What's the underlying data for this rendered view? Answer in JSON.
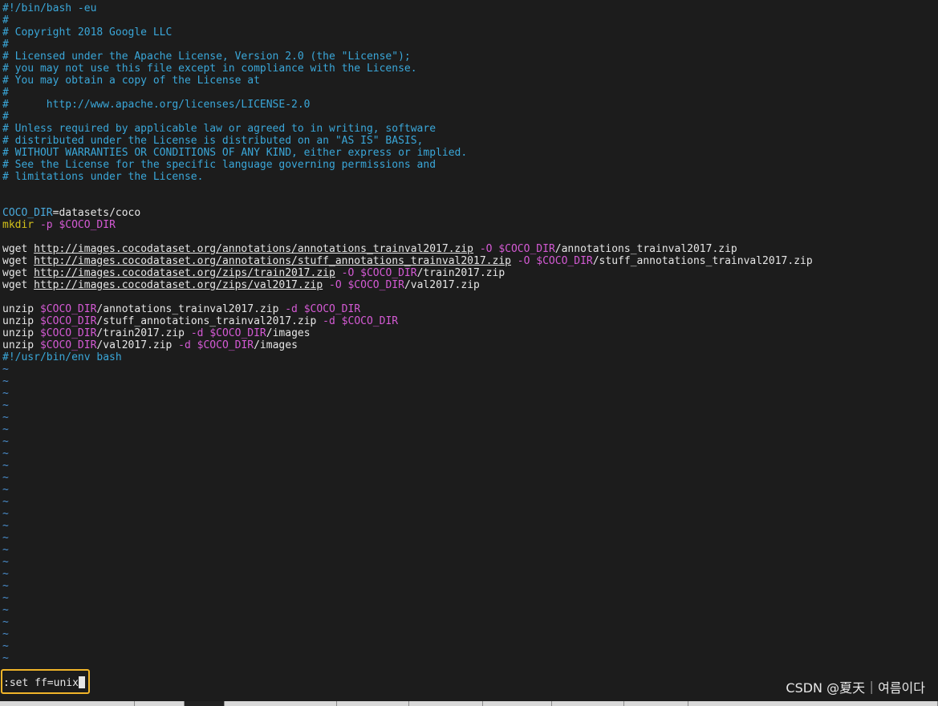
{
  "colors": {
    "background": "#1c1c1c",
    "comment": "#3aa7d9",
    "variable": "#d45ad4",
    "command": "#d4c21a",
    "text": "#e6e6e6",
    "tilde": "#4a8fcf",
    "highlight_box": "#f0b429"
  },
  "editor": {
    "lines": [
      [
        {
          "t": "#!/bin/bash -eu",
          "c": "shebang"
        }
      ],
      [
        {
          "t": "#",
          "c": "comment"
        }
      ],
      [
        {
          "t": "# Copyright 2018 Google LLC",
          "c": "comment"
        }
      ],
      [
        {
          "t": "#",
          "c": "comment"
        }
      ],
      [
        {
          "t": "# Licensed under the Apache License, Version 2.0 (the \"License\");",
          "c": "comment"
        }
      ],
      [
        {
          "t": "# you may not use this file except in compliance with the License.",
          "c": "comment"
        }
      ],
      [
        {
          "t": "# You may obtain a copy of the License at",
          "c": "comment"
        }
      ],
      [
        {
          "t": "#",
          "c": "comment"
        }
      ],
      [
        {
          "t": "#      http://www.apache.org/licenses/LICENSE-2.0",
          "c": "comment"
        }
      ],
      [
        {
          "t": "#",
          "c": "comment"
        }
      ],
      [
        {
          "t": "# Unless required by applicable law or agreed to in writing, software",
          "c": "comment"
        }
      ],
      [
        {
          "t": "# distributed under the License is distributed on an \"AS IS\" BASIS,",
          "c": "comment"
        }
      ],
      [
        {
          "t": "# WITHOUT WARRANTIES OR CONDITIONS OF ANY KIND, either express or implied.",
          "c": "comment"
        }
      ],
      [
        {
          "t": "# See the License for the specific language governing permissions and",
          "c": "comment"
        }
      ],
      [
        {
          "t": "# limitations under the License.",
          "c": "comment"
        }
      ],
      [],
      [],
      [
        {
          "t": "COCO_DIR",
          "c": "ident"
        },
        {
          "t": "=datasets/coco",
          "c": "plain"
        }
      ],
      [
        {
          "t": "mkdir",
          "c": "cmd"
        },
        {
          "t": " -p ",
          "c": "flag"
        },
        {
          "t": "$COCO_DIR",
          "c": "var"
        }
      ],
      [],
      [
        {
          "t": "wget ",
          "c": "plain"
        },
        {
          "t": "http://images.cocodataset.org/annotations/annotations_trainval2017.zip",
          "c": "url"
        },
        {
          "t": " -O ",
          "c": "flag"
        },
        {
          "t": "$COCO_DIR",
          "c": "var"
        },
        {
          "t": "/annotations_trainval2017.zip",
          "c": "plain"
        }
      ],
      [
        {
          "t": "wget ",
          "c": "plain"
        },
        {
          "t": "http://images.cocodataset.org/annotations/stuff_annotations_trainval2017.zip",
          "c": "url"
        },
        {
          "t": " -O ",
          "c": "flag"
        },
        {
          "t": "$COCO_DIR",
          "c": "var"
        },
        {
          "t": "/stuff_annotations_trainval2017.zip",
          "c": "plain"
        }
      ],
      [
        {
          "t": "wget ",
          "c": "plain"
        },
        {
          "t": "http://images.cocodataset.org/zips/train2017.zip",
          "c": "url"
        },
        {
          "t": " -O ",
          "c": "flag"
        },
        {
          "t": "$COCO_DIR",
          "c": "var"
        },
        {
          "t": "/train2017.zip",
          "c": "plain"
        }
      ],
      [
        {
          "t": "wget ",
          "c": "plain"
        },
        {
          "t": "http://images.cocodataset.org/zips/val2017.zip",
          "c": "url"
        },
        {
          "t": " -O ",
          "c": "flag"
        },
        {
          "t": "$COCO_DIR",
          "c": "var"
        },
        {
          "t": "/val2017.zip",
          "c": "plain"
        }
      ],
      [],
      [
        {
          "t": "unzip ",
          "c": "plain"
        },
        {
          "t": "$COCO_DIR",
          "c": "var"
        },
        {
          "t": "/annotations_trainval2017.zip",
          "c": "plain"
        },
        {
          "t": " -d ",
          "c": "flag"
        },
        {
          "t": "$COCO_DIR",
          "c": "var"
        }
      ],
      [
        {
          "t": "unzip ",
          "c": "plain"
        },
        {
          "t": "$COCO_DIR",
          "c": "var"
        },
        {
          "t": "/stuff_annotations_trainval2017.zip",
          "c": "plain"
        },
        {
          "t": " -d ",
          "c": "flag"
        },
        {
          "t": "$COCO_DIR",
          "c": "var"
        }
      ],
      [
        {
          "t": "unzip ",
          "c": "plain"
        },
        {
          "t": "$COCO_DIR",
          "c": "var"
        },
        {
          "t": "/train2017.zip",
          "c": "plain"
        },
        {
          "t": " -d ",
          "c": "flag"
        },
        {
          "t": "$COCO_DIR",
          "c": "var"
        },
        {
          "t": "/images",
          "c": "plain"
        }
      ],
      [
        {
          "t": "unzip ",
          "c": "plain"
        },
        {
          "t": "$COCO_DIR",
          "c": "var"
        },
        {
          "t": "/val2017.zip",
          "c": "plain"
        },
        {
          "t": " -d ",
          "c": "flag"
        },
        {
          "t": "$COCO_DIR",
          "c": "var"
        },
        {
          "t": "/images",
          "c": "plain"
        }
      ],
      [
        {
          "t": "#!/usr/bin/env bash",
          "c": "shebang"
        }
      ]
    ],
    "tilde_char": "~",
    "tilde_lines": 25
  },
  "command_line": {
    "text": ":set ff=unix"
  },
  "watermark": "CSDN @夏天｜여름이다"
}
